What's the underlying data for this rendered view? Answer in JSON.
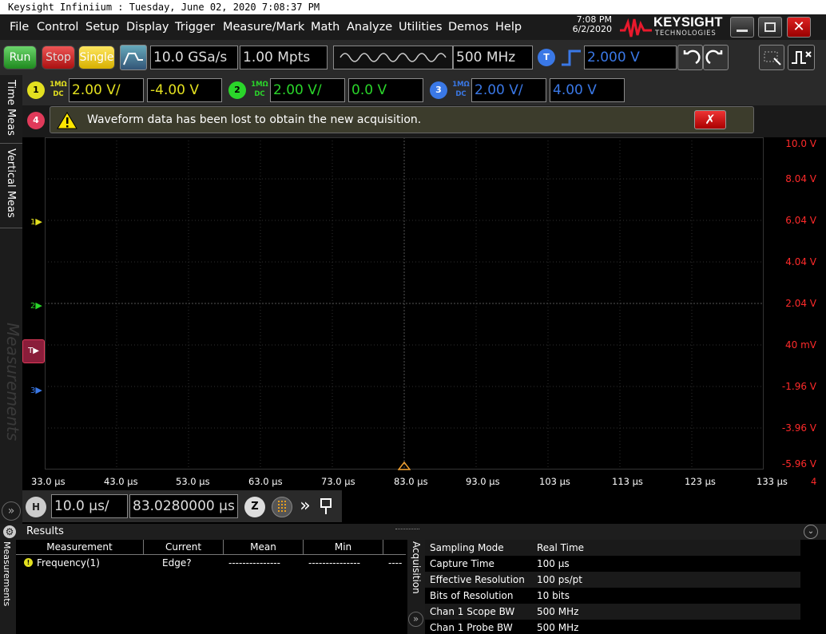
{
  "window": {
    "title": "Keysight Infiniium : Tuesday, June 02, 2020 7:08:37 PM"
  },
  "menu": [
    "File",
    "Control",
    "Setup",
    "Display",
    "Trigger",
    "Measure/Mark",
    "Math",
    "Analyze",
    "Utilities",
    "Demos",
    "Help"
  ],
  "clock": {
    "time": "7:08 PM",
    "date": "6/2/2020"
  },
  "logo": {
    "name": "KEYSIGHT",
    "sub": "TECHNOLOGIES"
  },
  "toolbar": {
    "run": "Run",
    "stop": "Stop",
    "single": "Single",
    "sample_rate": "10.0 GSa/s",
    "memory_depth": "1.00 Mpts",
    "bandwidth": "500 MHz",
    "trigger_badge": "T",
    "trigger_level": "2.000 V"
  },
  "channels": [
    {
      "num": "1",
      "coupling_top": "1MΩ",
      "coupling_bot": "DC",
      "scale": "2.00 V/",
      "offset": "-4.00 V",
      "color": "#e3e020"
    },
    {
      "num": "2",
      "coupling_top": "1MΩ",
      "coupling_bot": "DC",
      "scale": "2.00 V/",
      "offset": "0.0 V",
      "color": "#2ad52a"
    },
    {
      "num": "3",
      "coupling_top": "1MΩ",
      "coupling_bot": "DC",
      "scale": "2.00 V/",
      "offset": "4.00 V",
      "color": "#3a78e6"
    }
  ],
  "channel4": {
    "num": "4",
    "color": "#e03a5a"
  },
  "notice": {
    "text": "Waveform data has been lost to obtain the new acquisition."
  },
  "sidebar": {
    "tab1": "Time Meas",
    "tab2": "Vertical Meas",
    "watermark": "Measurements"
  },
  "y_labels": [
    "10.0 V",
    "8.04 V",
    "6.04 V",
    "4.04 V",
    "2.04 V",
    "40 mV",
    "-1.96 V",
    "-3.96 V",
    "-5.96 V"
  ],
  "x_labels": [
    "33.0 µs",
    "43.0 µs",
    "53.0 µs",
    "63.0 µs",
    "73.0 µs",
    "83.0 µs",
    "93.0 µs",
    "103 µs",
    "113 µs",
    "123 µs",
    "133 µs"
  ],
  "x_edge_label": "4",
  "markers": {
    "ch1": "1",
    "ch2": "2",
    "trig": "T",
    "ch3": "3"
  },
  "horizontal": {
    "badge": "H",
    "scale": "10.0 µs/",
    "position": "83.0280000 µs",
    "zoom": "Z"
  },
  "results": {
    "title": "Results",
    "side_label": "Measurements",
    "columns": [
      "Measurement",
      "Current",
      "Mean",
      "Min",
      "---"
    ],
    "rows": [
      {
        "name": "Frequency(1)",
        "current": "Edge?",
        "mean": "---------------",
        "min": "---------------",
        "max": "----"
      }
    ]
  },
  "acquisition": {
    "side_label": "Acquisition",
    "rows": [
      {
        "k": "Sampling Mode",
        "v": "Real Time"
      },
      {
        "k": "Capture Time",
        "v": "100 µs"
      },
      {
        "k": "Effective Resolution",
        "v": "100 ps/pt"
      },
      {
        "k": "Bits of Resolution",
        "v": "10 bits"
      },
      {
        "k": "Chan 1 Scope BW",
        "v": "500 MHz"
      },
      {
        "k": "Chan 1 Probe BW",
        "v": "500 MHz"
      }
    ]
  }
}
